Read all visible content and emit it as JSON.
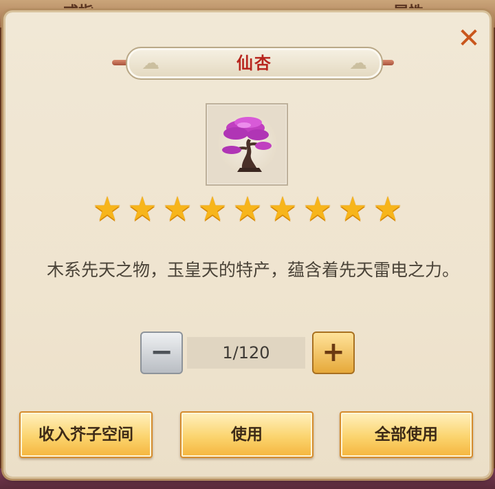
{
  "background": {
    "tab_left": "戒指",
    "tab_right": "属性"
  },
  "dialog": {
    "title": "仙杏",
    "item_icon": "pink-blossom-tree-icon",
    "star_count": 9,
    "description": "木系先天之物，玉皇天的特产，蕴含着先天雷电之力。",
    "quantity": {
      "display": "1/120",
      "minus_label": "−",
      "plus_label": "+"
    },
    "buttons": {
      "store": "收入芥子空间",
      "use": "使用",
      "use_all": "全部使用"
    },
    "close_label": "✕"
  },
  "colors": {
    "title_red": "#b8261e",
    "star_gold": "#f7b51b",
    "close_orange": "#c9561c",
    "button_gold": "#fbd46e"
  }
}
